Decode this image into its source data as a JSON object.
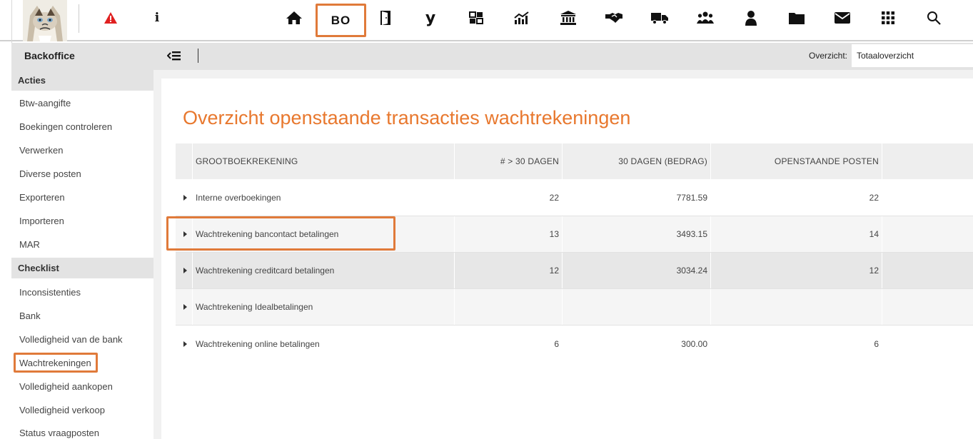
{
  "topbar": {
    "icons": [
      "home-icon",
      "backoffice-icon",
      "door-icon",
      "y-icon",
      "grid-boxes-icon",
      "chart-icon",
      "bank-icon",
      "handshake-icon",
      "truck-icon",
      "people-icon",
      "person-icon",
      "folder-icon",
      "mail-icon",
      "apps-icon",
      "search-icon"
    ],
    "bo_label": "BO",
    "y_label": "y",
    "info_label": "i",
    "accent": "#e07a3a",
    "warning_color": "#e02020"
  },
  "subbar": {
    "title": "Backoffice",
    "overzicht_label": "Overzicht:",
    "overzicht_value": "Totaaloverzicht"
  },
  "sidebar": {
    "sections": [
      {
        "label": "Acties",
        "items": [
          "Btw-aangifte",
          "Boekingen controleren",
          "Verwerken",
          "Diverse posten",
          "Exporteren",
          "Importeren",
          "MAR"
        ]
      },
      {
        "label": "Checklist",
        "items": [
          "Inconsistenties",
          "Bank",
          "Volledigheid van de bank",
          "Wachtrekeningen",
          "Volledigheid aankopen",
          "Volledigheid verkoop",
          "Status vraagposten"
        ]
      }
    ],
    "active": "Wachtrekeningen"
  },
  "main": {
    "title": "Overzicht openstaande transacties wachtrekeningen",
    "columns": [
      "GROOTBOEKREKENING",
      "# > 30 DAGEN",
      "30 DAGEN (BEDRAG)",
      "OPENSTAANDE POSTEN"
    ],
    "rows": [
      {
        "name": "Interne overboekingen",
        "count": "22",
        "amount": "7781.59",
        "open": "22"
      },
      {
        "name": "Wachtrekening bancontact betalingen",
        "count": "13",
        "amount": "3493.15",
        "open": "14"
      },
      {
        "name": "Wachtrekening creditcard betalingen",
        "count": "12",
        "amount": "3034.24",
        "open": "12"
      },
      {
        "name": "Wachtrekening Idealbetalingen",
        "count": "",
        "amount": "",
        "open": ""
      },
      {
        "name": "Wachtrekening online betalingen",
        "count": "6",
        "amount": "300.00",
        "open": "6"
      }
    ],
    "title_color": "#e8782e"
  }
}
